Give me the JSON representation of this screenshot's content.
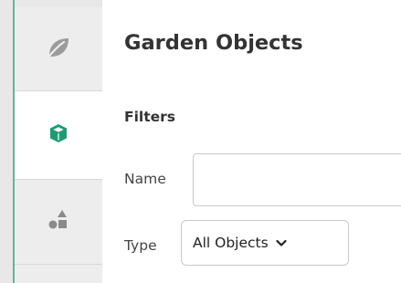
{
  "sidebar": {
    "tabs": [
      {
        "icon": "leaf-icon"
      },
      {
        "icon": "cube-icon",
        "active": true
      },
      {
        "icon": "shapes-icon"
      },
      {
        "icon": ""
      }
    ],
    "accent_color": "#4fbe97",
    "active_icon_color": "#1f9a74"
  },
  "main": {
    "title": "Garden Objects",
    "filters": {
      "heading": "Filters",
      "name_label": "Name",
      "name_value": "",
      "type_label": "Type",
      "type_value": "All Objects"
    }
  }
}
